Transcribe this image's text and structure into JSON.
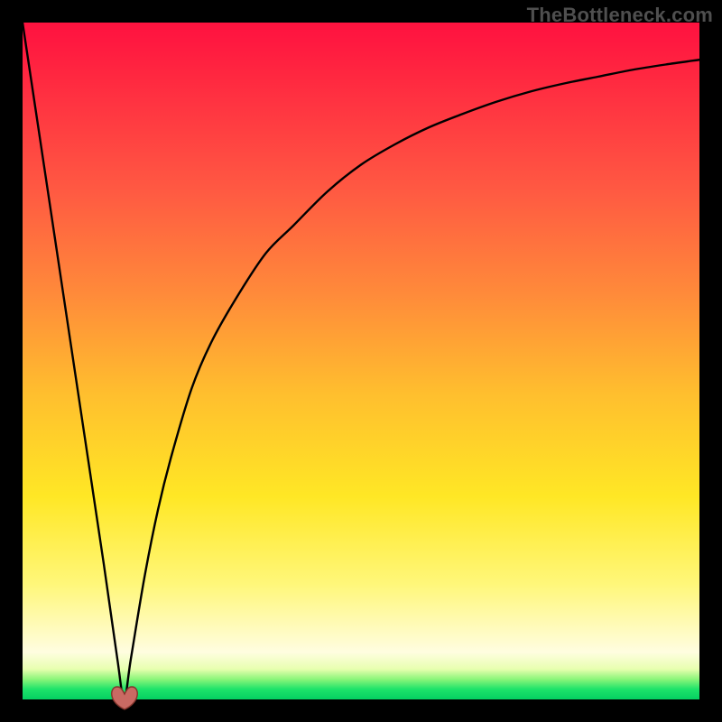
{
  "watermark": "TheBottleneck.com",
  "colors": {
    "frame_bg": "#000000",
    "curve_stroke": "#000000",
    "heart_fill": "#c6605a",
    "heart_stroke": "#7a2921",
    "gradient_stops": [
      "#ff123f",
      "#ff5a42",
      "#ff8a3a",
      "#ffbf2e",
      "#ffe725",
      "#fff77a",
      "#fffde0",
      "#e8ffb0",
      "#8cf57a",
      "#1de36a",
      "#05d061"
    ]
  },
  "chart_data": {
    "type": "line",
    "title": "",
    "xlabel": "",
    "ylabel": "",
    "xlim": [
      0,
      100
    ],
    "ylim": [
      0,
      100
    ],
    "grid": false,
    "legend": false,
    "annotations": [
      {
        "kind": "heart-marker",
        "x": 15,
        "y": 0
      }
    ],
    "notes": "Background is a vertical bottleneck heatmap gradient (red=high bottleneck at top, green=no bottleneck at bottom). The black curve is percent-bottleneck vs an unlabeled x-axis; it drops to 0 at x≈15 then rises asymptotically toward ~95 at x=100. No tick labels are visible.",
    "series": [
      {
        "name": "bottleneck_percent",
        "x": [
          0,
          3,
          6,
          9,
          12,
          14,
          15,
          16,
          18,
          20,
          22,
          25,
          28,
          32,
          36,
          40,
          45,
          50,
          55,
          60,
          65,
          70,
          75,
          80,
          85,
          90,
          95,
          100
        ],
        "y": [
          100,
          80,
          60,
          40,
          20,
          6,
          0,
          6,
          18,
          28,
          36,
          46,
          53,
          60,
          66,
          70,
          75,
          79,
          82,
          84.5,
          86.5,
          88.3,
          89.8,
          91,
          92,
          93,
          93.8,
          94.5
        ]
      }
    ]
  }
}
